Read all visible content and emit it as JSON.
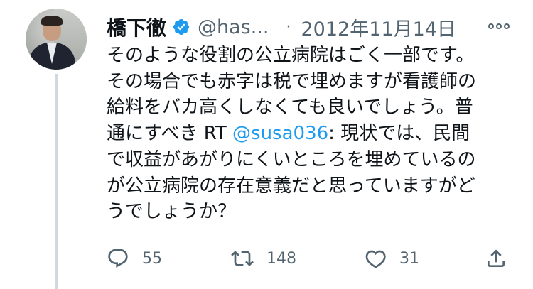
{
  "tweet": {
    "author_name": "橋下徹",
    "handle": "@has...",
    "separator": "·",
    "date": "2012年11月14日",
    "text_before_mention": "そのような役割の公立病院はごく一部です。\nその場合でも赤字は税で埋めますが看護師の\n給料をバカ高くしなくても良いでしょう。普\n通にすべき RT ",
    "mention": "@susa036",
    "text_after_mention": ": 現状では、民間\nで収益があがりにくいところを埋めているの\nが公立病院の存在意義だと思っていますがど\nうでしょうか？",
    "verified": true
  },
  "actions": {
    "reply_count": "55",
    "retweet_count": "148",
    "like_count": "31"
  },
  "icons": {
    "verified": "verified-badge-icon",
    "more": "more-options-icon",
    "reply": "reply-icon",
    "retweet": "retweet-icon",
    "like": "heart-icon",
    "share": "share-icon"
  },
  "colors": {
    "text": "#0f1419",
    "muted": "#536471",
    "accent": "#1d9bf0",
    "thread_line": "#cfd9de"
  }
}
